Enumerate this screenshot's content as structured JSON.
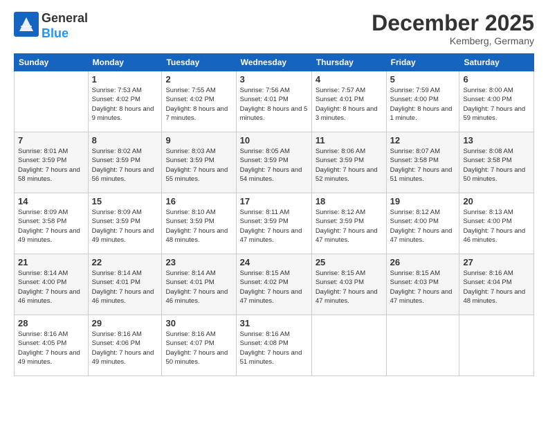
{
  "logo": {
    "general": "General",
    "blue": "Blue"
  },
  "header": {
    "month": "December 2025",
    "location": "Kemberg, Germany"
  },
  "weekdays": [
    "Sunday",
    "Monday",
    "Tuesday",
    "Wednesday",
    "Thursday",
    "Friday",
    "Saturday"
  ],
  "weeks": [
    [
      {
        "day": "",
        "sunrise": "",
        "sunset": "",
        "daylight": ""
      },
      {
        "day": "1",
        "sunrise": "Sunrise: 7:53 AM",
        "sunset": "Sunset: 4:02 PM",
        "daylight": "Daylight: 8 hours and 9 minutes."
      },
      {
        "day": "2",
        "sunrise": "Sunrise: 7:55 AM",
        "sunset": "Sunset: 4:02 PM",
        "daylight": "Daylight: 8 hours and 7 minutes."
      },
      {
        "day": "3",
        "sunrise": "Sunrise: 7:56 AM",
        "sunset": "Sunset: 4:01 PM",
        "daylight": "Daylight: 8 hours and 5 minutes."
      },
      {
        "day": "4",
        "sunrise": "Sunrise: 7:57 AM",
        "sunset": "Sunset: 4:01 PM",
        "daylight": "Daylight: 8 hours and 3 minutes."
      },
      {
        "day": "5",
        "sunrise": "Sunrise: 7:59 AM",
        "sunset": "Sunset: 4:00 PM",
        "daylight": "Daylight: 8 hours and 1 minute."
      },
      {
        "day": "6",
        "sunrise": "Sunrise: 8:00 AM",
        "sunset": "Sunset: 4:00 PM",
        "daylight": "Daylight: 7 hours and 59 minutes."
      }
    ],
    [
      {
        "day": "7",
        "sunrise": "Sunrise: 8:01 AM",
        "sunset": "Sunset: 3:59 PM",
        "daylight": "Daylight: 7 hours and 58 minutes."
      },
      {
        "day": "8",
        "sunrise": "Sunrise: 8:02 AM",
        "sunset": "Sunset: 3:59 PM",
        "daylight": "Daylight: 7 hours and 56 minutes."
      },
      {
        "day": "9",
        "sunrise": "Sunrise: 8:03 AM",
        "sunset": "Sunset: 3:59 PM",
        "daylight": "Daylight: 7 hours and 55 minutes."
      },
      {
        "day": "10",
        "sunrise": "Sunrise: 8:05 AM",
        "sunset": "Sunset: 3:59 PM",
        "daylight": "Daylight: 7 hours and 54 minutes."
      },
      {
        "day": "11",
        "sunrise": "Sunrise: 8:06 AM",
        "sunset": "Sunset: 3:59 PM",
        "daylight": "Daylight: 7 hours and 52 minutes."
      },
      {
        "day": "12",
        "sunrise": "Sunrise: 8:07 AM",
        "sunset": "Sunset: 3:58 PM",
        "daylight": "Daylight: 7 hours and 51 minutes."
      },
      {
        "day": "13",
        "sunrise": "Sunrise: 8:08 AM",
        "sunset": "Sunset: 3:58 PM",
        "daylight": "Daylight: 7 hours and 50 minutes."
      }
    ],
    [
      {
        "day": "14",
        "sunrise": "Sunrise: 8:09 AM",
        "sunset": "Sunset: 3:58 PM",
        "daylight": "Daylight: 7 hours and 49 minutes."
      },
      {
        "day": "15",
        "sunrise": "Sunrise: 8:09 AM",
        "sunset": "Sunset: 3:59 PM",
        "daylight": "Daylight: 7 hours and 49 minutes."
      },
      {
        "day": "16",
        "sunrise": "Sunrise: 8:10 AM",
        "sunset": "Sunset: 3:59 PM",
        "daylight": "Daylight: 7 hours and 48 minutes."
      },
      {
        "day": "17",
        "sunrise": "Sunrise: 8:11 AM",
        "sunset": "Sunset: 3:59 PM",
        "daylight": "Daylight: 7 hours and 47 minutes."
      },
      {
        "day": "18",
        "sunrise": "Sunrise: 8:12 AM",
        "sunset": "Sunset: 3:59 PM",
        "daylight": "Daylight: 7 hours and 47 minutes."
      },
      {
        "day": "19",
        "sunrise": "Sunrise: 8:12 AM",
        "sunset": "Sunset: 4:00 PM",
        "daylight": "Daylight: 7 hours and 47 minutes."
      },
      {
        "day": "20",
        "sunrise": "Sunrise: 8:13 AM",
        "sunset": "Sunset: 4:00 PM",
        "daylight": "Daylight: 7 hours and 46 minutes."
      }
    ],
    [
      {
        "day": "21",
        "sunrise": "Sunrise: 8:14 AM",
        "sunset": "Sunset: 4:00 PM",
        "daylight": "Daylight: 7 hours and 46 minutes."
      },
      {
        "day": "22",
        "sunrise": "Sunrise: 8:14 AM",
        "sunset": "Sunset: 4:01 PM",
        "daylight": "Daylight: 7 hours and 46 minutes."
      },
      {
        "day": "23",
        "sunrise": "Sunrise: 8:14 AM",
        "sunset": "Sunset: 4:01 PM",
        "daylight": "Daylight: 7 hours and 46 minutes."
      },
      {
        "day": "24",
        "sunrise": "Sunrise: 8:15 AM",
        "sunset": "Sunset: 4:02 PM",
        "daylight": "Daylight: 7 hours and 47 minutes."
      },
      {
        "day": "25",
        "sunrise": "Sunrise: 8:15 AM",
        "sunset": "Sunset: 4:03 PM",
        "daylight": "Daylight: 7 hours and 47 minutes."
      },
      {
        "day": "26",
        "sunrise": "Sunrise: 8:15 AM",
        "sunset": "Sunset: 4:03 PM",
        "daylight": "Daylight: 7 hours and 47 minutes."
      },
      {
        "day": "27",
        "sunrise": "Sunrise: 8:16 AM",
        "sunset": "Sunset: 4:04 PM",
        "daylight": "Daylight: 7 hours and 48 minutes."
      }
    ],
    [
      {
        "day": "28",
        "sunrise": "Sunrise: 8:16 AM",
        "sunset": "Sunset: 4:05 PM",
        "daylight": "Daylight: 7 hours and 49 minutes."
      },
      {
        "day": "29",
        "sunrise": "Sunrise: 8:16 AM",
        "sunset": "Sunset: 4:06 PM",
        "daylight": "Daylight: 7 hours and 49 minutes."
      },
      {
        "day": "30",
        "sunrise": "Sunrise: 8:16 AM",
        "sunset": "Sunset: 4:07 PM",
        "daylight": "Daylight: 7 hours and 50 minutes."
      },
      {
        "day": "31",
        "sunrise": "Sunrise: 8:16 AM",
        "sunset": "Sunset: 4:08 PM",
        "daylight": "Daylight: 7 hours and 51 minutes."
      },
      {
        "day": "",
        "sunrise": "",
        "sunset": "",
        "daylight": ""
      },
      {
        "day": "",
        "sunrise": "",
        "sunset": "",
        "daylight": ""
      },
      {
        "day": "",
        "sunrise": "",
        "sunset": "",
        "daylight": ""
      }
    ]
  ]
}
